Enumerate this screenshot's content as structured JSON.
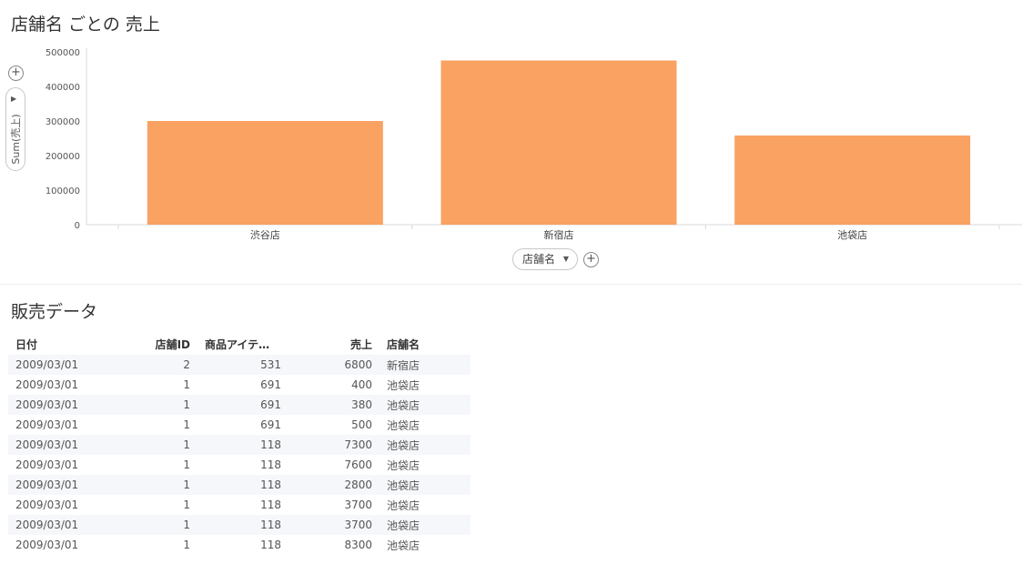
{
  "chart": {
    "title": "店舗名 ごとの 売上",
    "y_axis_label": "Sum(売上)",
    "x_axis_label": "店舗名"
  },
  "chart_data": {
    "type": "bar",
    "categories": [
      "渋谷店",
      "新宿店",
      "池袋店"
    ],
    "series": [
      {
        "values": [
          300000,
          475000,
          258000
        ]
      }
    ],
    "ylabel": "Sum(売上)",
    "xlabel": "店舗名",
    "ylim": [
      0,
      500000
    ],
    "y_ticks": [
      "500000",
      "400000",
      "300000",
      "200000",
      "100000",
      "0"
    ],
    "bar_color": "#f9a262",
    "grid": false
  },
  "table": {
    "title": "販売データ",
    "headers": [
      "日付",
      "店舗ID",
      "商品アイテ…",
      "売上",
      "店舗名"
    ],
    "rows": [
      [
        "2009/03/01",
        "2",
        "531",
        "6800",
        "新宿店"
      ],
      [
        "2009/03/01",
        "1",
        "691",
        "400",
        "池袋店"
      ],
      [
        "2009/03/01",
        "1",
        "691",
        "380",
        "池袋店"
      ],
      [
        "2009/03/01",
        "1",
        "691",
        "500",
        "池袋店"
      ],
      [
        "2009/03/01",
        "1",
        "118",
        "7300",
        "池袋店"
      ],
      [
        "2009/03/01",
        "1",
        "118",
        "7600",
        "池袋店"
      ],
      [
        "2009/03/01",
        "1",
        "118",
        "2800",
        "池袋店"
      ],
      [
        "2009/03/01",
        "1",
        "118",
        "3700",
        "池袋店"
      ],
      [
        "2009/03/01",
        "1",
        "118",
        "3700",
        "池袋店"
      ],
      [
        "2009/03/01",
        "1",
        "118",
        "8300",
        "池袋店"
      ]
    ]
  },
  "icons": {
    "add": "+",
    "dropdown": "▼"
  }
}
